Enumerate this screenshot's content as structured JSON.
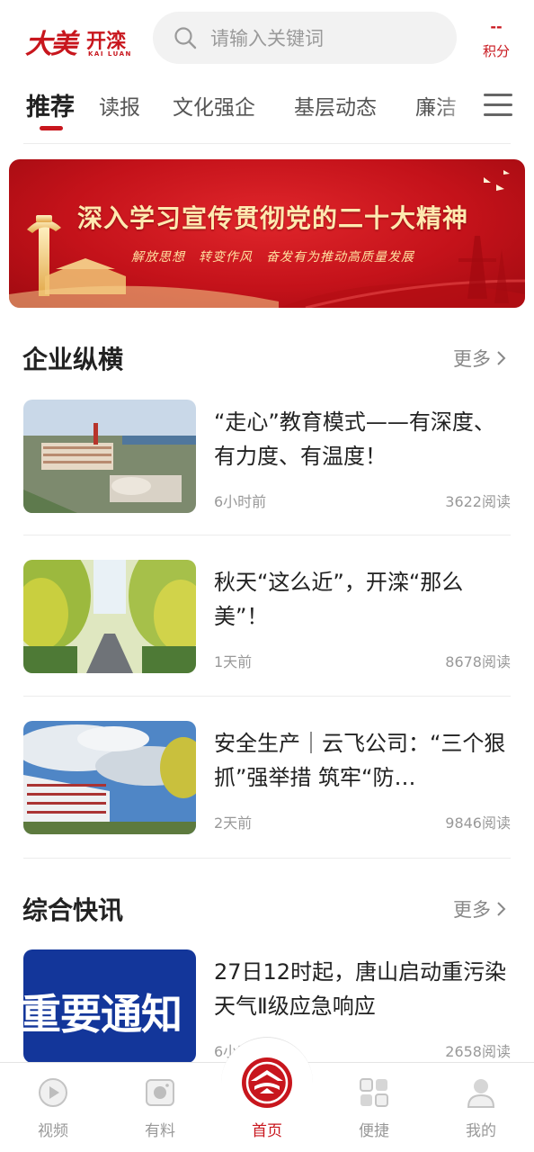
{
  "header": {
    "logo_big": "大美",
    "logo_name": "开滦",
    "logo_en": "KAI LUAN",
    "search_placeholder": "请输入关键词",
    "points_value": "--",
    "points_label": "积分"
  },
  "tabs": [
    {
      "label": "推荐",
      "active": true
    },
    {
      "label": "读报"
    },
    {
      "label": "文化强企"
    },
    {
      "label": "基层动态"
    },
    {
      "label": "廉洁"
    }
  ],
  "banner": {
    "title": "深入学习宣传贯彻党的二十大精神",
    "subtitle": "解放思想　转变作风　奋发有为推动高质量发展"
  },
  "sections": [
    {
      "title": "企业纵横",
      "more": "更多",
      "articles": [
        {
          "title": "“走心”教育模式——有深度、有力度、有温度！",
          "time": "6小时前",
          "reads": "3622阅读"
        },
        {
          "title": "秋天“这么近”，开滦“那么美”！",
          "time": "1天前",
          "reads": "8678阅读"
        },
        {
          "title": "安全生产｜云飞公司：“三个狠抓”强举措 筑牢“防…",
          "time": "2天前",
          "reads": "9846阅读"
        }
      ]
    },
    {
      "title": "综合快讯",
      "more": "更多",
      "articles": [
        {
          "title": "27日12时起，唐山启动重污染天气Ⅱ级应急响应",
          "time": "6小时前",
          "reads": "2658阅读",
          "thumb_text": "重要通知"
        }
      ]
    }
  ],
  "bottom_nav": [
    {
      "label": "视频",
      "icon": "play-icon"
    },
    {
      "label": "有料",
      "icon": "camera-icon"
    },
    {
      "label": "首页",
      "icon": "home-logo-icon",
      "active": true
    },
    {
      "label": "便捷",
      "icon": "grid-icon"
    },
    {
      "label": "我的",
      "icon": "user-icon"
    }
  ],
  "colors": {
    "accent": "#c8161d",
    "muted": "#999999"
  }
}
